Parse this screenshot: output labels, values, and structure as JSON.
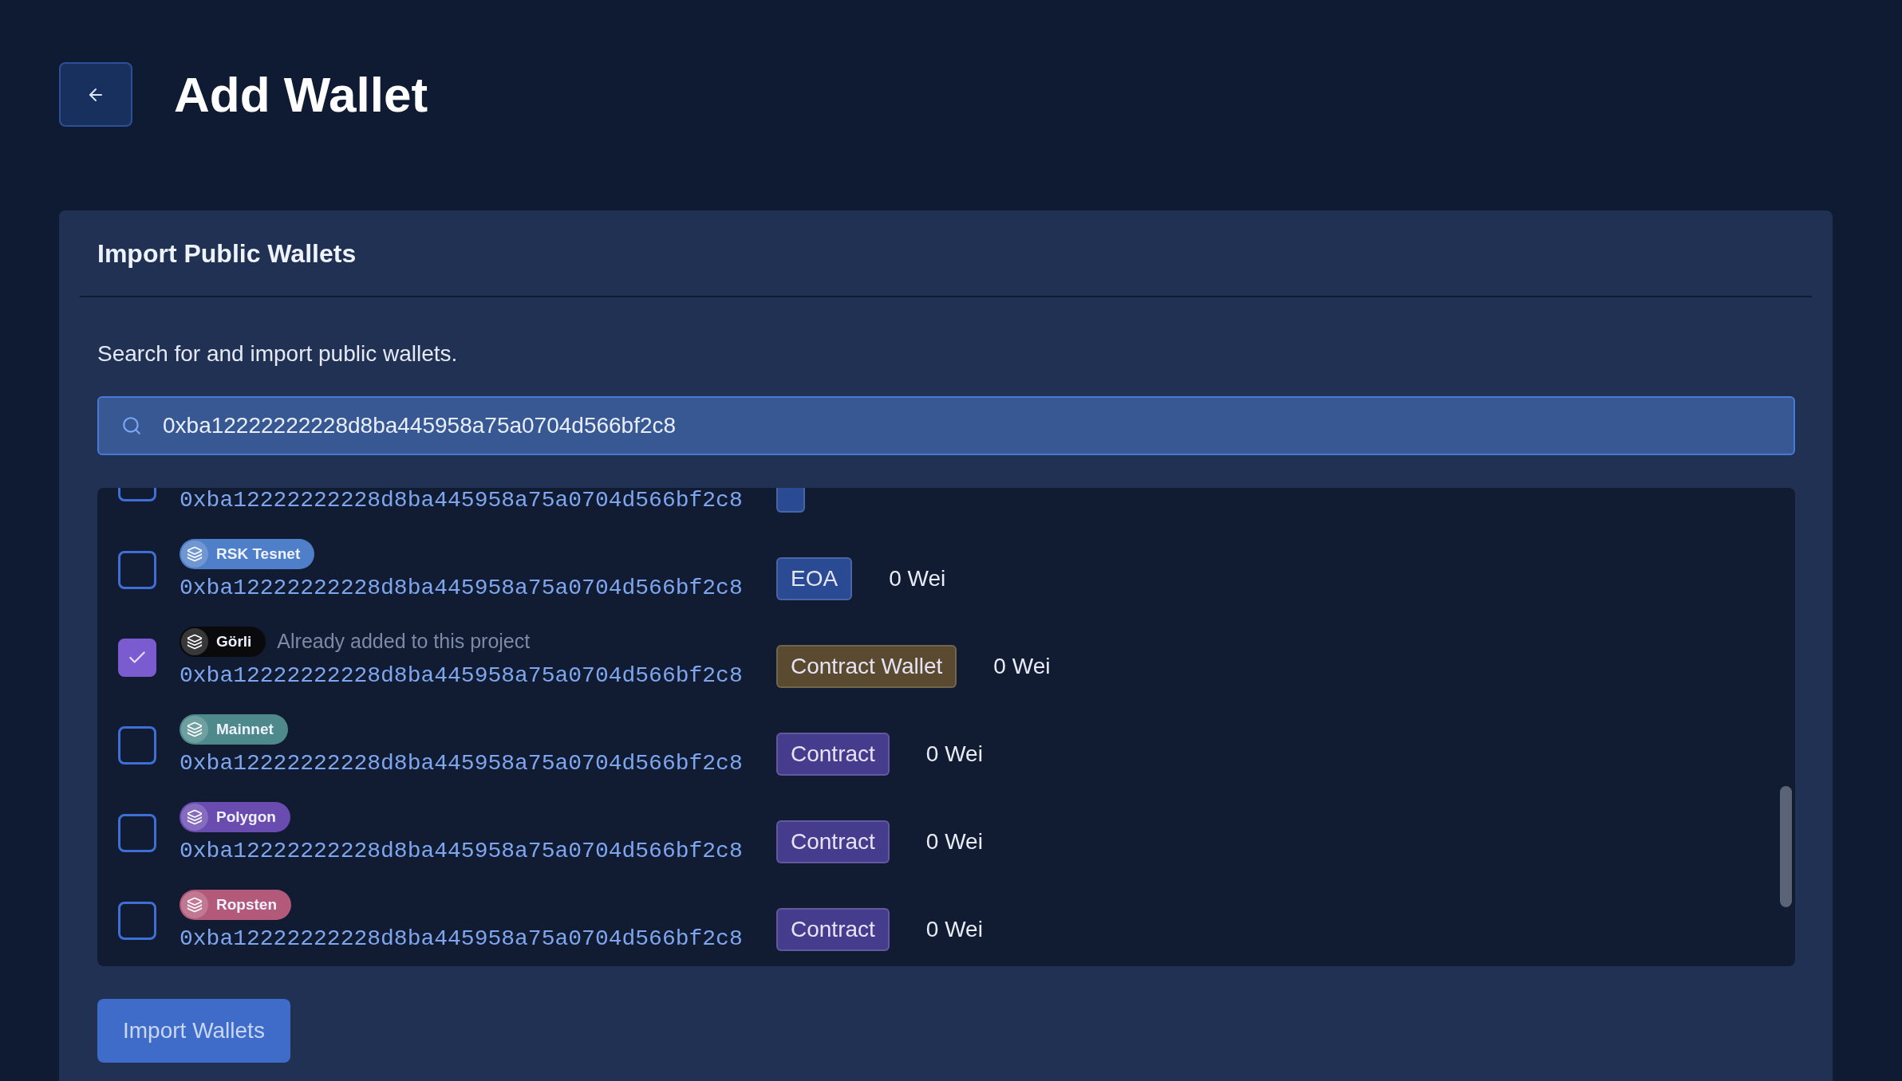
{
  "header": {
    "title": "Add Wallet"
  },
  "card": {
    "title": "Import Public Wallets",
    "description": "Search for and import public wallets.",
    "search": {
      "value": "0xba12222222228d8ba445958a75a0704d566bf2c8"
    },
    "wallets": [
      {
        "kind": "partial",
        "checked": false,
        "address": "0xba12222222228d8ba445958a75a0704d566bf2c8",
        "type": {
          "color": "#2a4a94"
        }
      },
      {
        "kind": "full",
        "checked": false,
        "network": "RSK Tesnet",
        "color": "#4f7fc8",
        "address": "0xba12222222228d8ba445958a75a0704d566bf2c8",
        "type": {
          "label": "EOA",
          "color": "#2a4a94"
        },
        "balance": "0 Wei"
      },
      {
        "kind": "full",
        "checked": true,
        "network": "Görli",
        "color": "#0a0a0c",
        "note": "Already added to this project",
        "address": "0xba12222222228d8ba445958a75a0704d566bf2c8",
        "type": {
          "label": "Contract Wallet",
          "color": "#5a4a30"
        },
        "balance": "0 Wei"
      },
      {
        "kind": "full",
        "checked": false,
        "network": "Mainnet",
        "color": "#4e8a8c",
        "address": "0xba12222222228d8ba445958a75a0704d566bf2c8",
        "type": {
          "label": "Contract",
          "color": "#463c8e"
        },
        "balance": "0 Wei"
      },
      {
        "kind": "full",
        "checked": false,
        "network": "Polygon",
        "color": "#6a4bb0",
        "address": "0xba12222222228d8ba445958a75a0704d566bf2c8",
        "type": {
          "label": "Contract",
          "color": "#463c8e"
        },
        "balance": "0 Wei"
      },
      {
        "kind": "full",
        "checked": false,
        "network": "Ropsten",
        "color": "#b3597a",
        "address": "0xba12222222228d8ba445958a75a0704d566bf2c8",
        "type": {
          "label": "Contract",
          "color": "#463c8e"
        },
        "balance": "0 Wei"
      }
    ],
    "button": "Import Wallets"
  }
}
